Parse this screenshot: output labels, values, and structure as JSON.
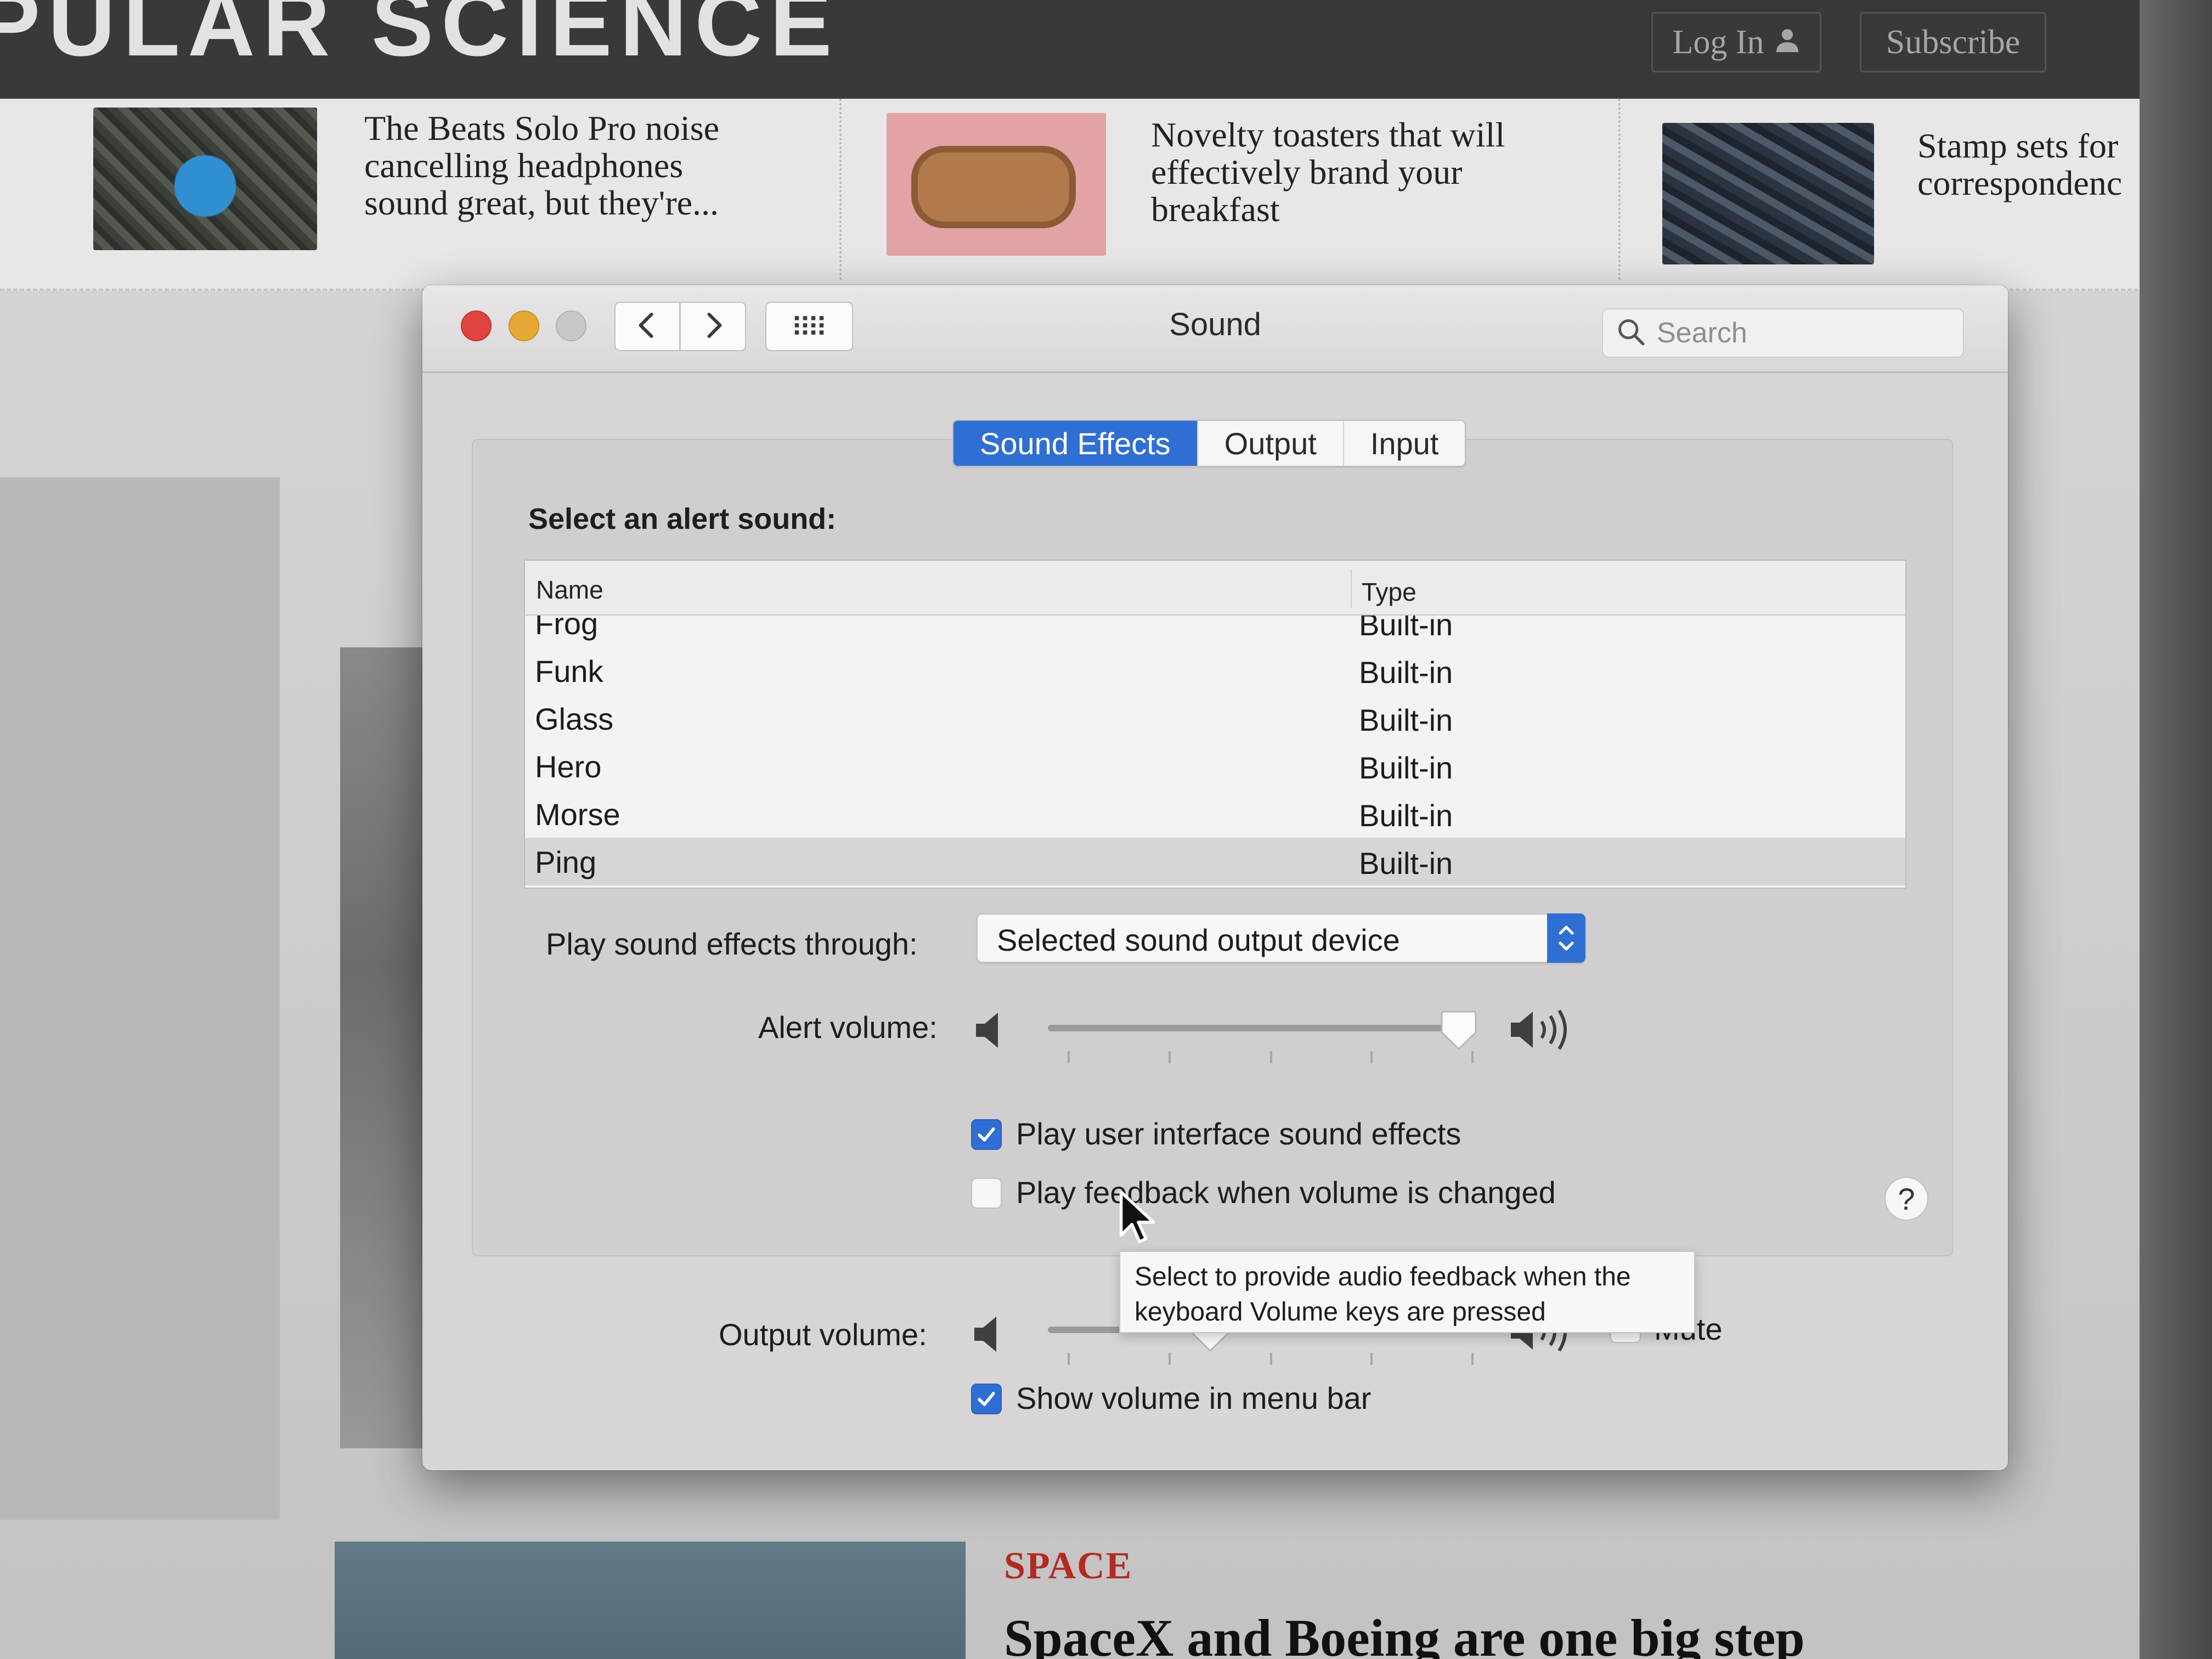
{
  "site": {
    "logo": "PULAR SCIENCE",
    "login_label": "Log In",
    "subscribe_label": "Subscribe",
    "strip": [
      {
        "lines": [
          "The Beats Solo Pro noise",
          "cancelling headphones",
          "sound great, but they're..."
        ]
      },
      {
        "lines": [
          "Novelty toasters that will",
          "effectively brand your",
          "breakfast"
        ]
      },
      {
        "lines": [
          "Stamp sets for",
          "correspondenc"
        ]
      }
    ],
    "section_tag": "SPACE",
    "headline": "SpaceX and Boeing are one big step"
  },
  "window": {
    "title": "Sound",
    "search_placeholder": "Search"
  },
  "tabs": [
    {
      "label": "Sound Effects",
      "active": true
    },
    {
      "label": "Output",
      "active": false
    },
    {
      "label": "Input",
      "active": false
    }
  ],
  "alert_section": {
    "label": "Select an alert sound:",
    "columns": {
      "name": "Name",
      "type": "Type"
    },
    "rows": [
      {
        "name": "Frog",
        "type": "Built-in",
        "selected": false
      },
      {
        "name": "Funk",
        "type": "Built-in",
        "selected": false
      },
      {
        "name": "Glass",
        "type": "Built-in",
        "selected": false
      },
      {
        "name": "Hero",
        "type": "Built-in",
        "selected": false
      },
      {
        "name": "Morse",
        "type": "Built-in",
        "selected": false
      },
      {
        "name": "Ping",
        "type": "Built-in",
        "selected": true
      }
    ]
  },
  "play_through": {
    "label": "Play sound effects through:",
    "value": "Selected sound output device"
  },
  "alert_volume": {
    "label": "Alert volume:",
    "level": 0.96
  },
  "checkboxes": {
    "ui_sounds": {
      "label": "Play user interface sound effects",
      "checked": true
    },
    "feedback": {
      "label": "Play feedback when volume is changed",
      "checked": false
    },
    "show_volume": {
      "label": "Show volume in menu bar",
      "checked": true
    }
  },
  "help_label": "?",
  "tooltip": {
    "line1": "Select to provide audio feedback when the",
    "line2": "keyboard Volume keys are pressed"
  },
  "output_volume": {
    "label": "Output volume:",
    "level": 0.38,
    "mute_label": "Mute",
    "muted": false
  },
  "colors": {
    "accent": "#2f6fd4",
    "close": "#e0443e",
    "minimize": "#e6a935",
    "zoom_disabled": "#c8c6c7",
    "section_tag": "#b22a22"
  },
  "icons": {
    "back": "chevron-left-icon",
    "forward": "chevron-right-icon",
    "show_all": "grid-icon",
    "search": "search-icon",
    "speaker_low": "speaker-low-icon",
    "speaker_high": "speaker-high-icon",
    "checkmark": "checkmark-icon",
    "user": "user-icon"
  }
}
